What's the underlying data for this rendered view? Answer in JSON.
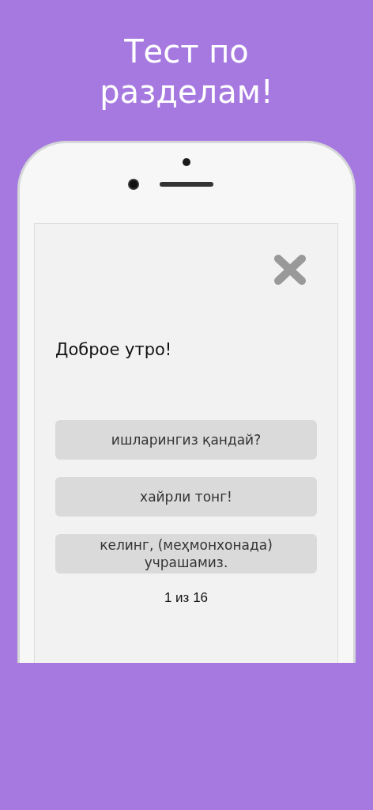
{
  "title": "Тест по разделам!",
  "question": "Доброе утро!",
  "options": [
    {
      "text": "ишларингиз қандай?"
    },
    {
      "text": "хайрли тонг!"
    },
    {
      "text": "келинг, (меҳмонхонада) учрашамиз."
    }
  ],
  "counter": "1 из 16"
}
